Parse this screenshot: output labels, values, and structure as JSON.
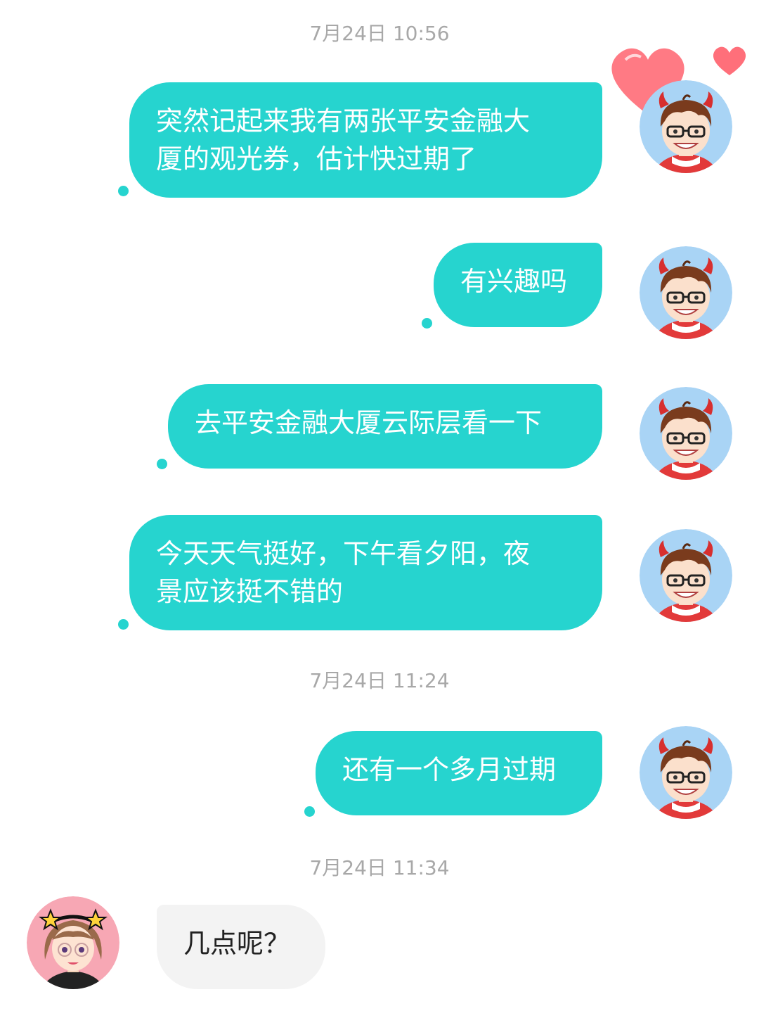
{
  "timestamps": [
    "7月24日 10:56",
    "7月24日 11:24",
    "7月24日 11:34"
  ],
  "messages": [
    {
      "sender": "me",
      "text": "突然记起来我有两张平安金融大\n厦的观光券，估计快过期了"
    },
    {
      "sender": "me",
      "text": "有兴趣吗"
    },
    {
      "sender": "me",
      "text": "去平安金融大厦云际层看一下"
    },
    {
      "sender": "me",
      "text": "今天天气挺好，下午看夕阳，夜\n景应该挺不错的"
    },
    {
      "sender": "me",
      "text": "还有一个多月过期"
    },
    {
      "sender": "other",
      "text": "几点呢？"
    }
  ],
  "colors": {
    "outgoing_bubble": "#26d4cf",
    "incoming_bubble": "#f3f3f3",
    "timestamp_text": "#a8a8a8",
    "heart": "#ff6f7a"
  },
  "icons": {
    "my_avatar": "boy-with-devil-horns-avatar",
    "other_avatar": "girl-with-star-headband-avatar",
    "hearts": "heart-sticker"
  }
}
